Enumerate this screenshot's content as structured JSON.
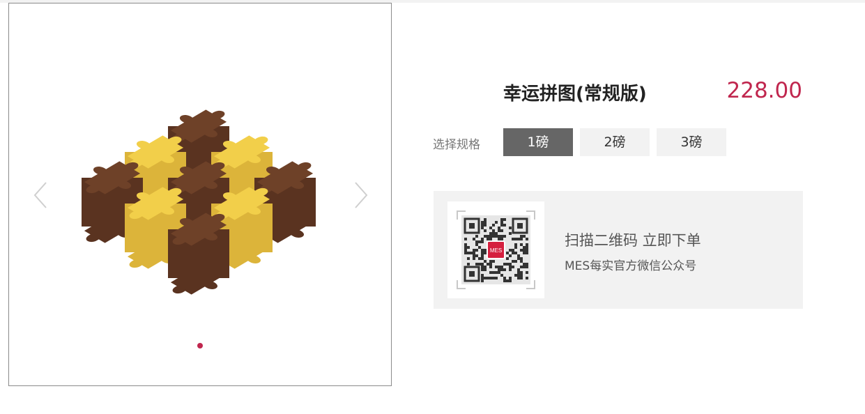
{
  "product": {
    "title": "幸运拼图(常规版)",
    "price": "228.00"
  },
  "spec": {
    "label": "选择规格",
    "options": [
      "1磅",
      "2磅",
      "3磅"
    ],
    "selected": "1磅"
  },
  "qr": {
    "line1": "扫描二维码 立即下单",
    "line2": "MES每实官方微信公众号",
    "logo_text": "MES"
  },
  "gallery": {
    "arrow_prev_icon": "chevron-left-icon",
    "arrow_next_icon": "chevron-right-icon"
  },
  "colors": {
    "accent": "#c0264e",
    "selected_bg": "#666666",
    "option_bg": "#f2f2f2",
    "chocolate": "#6e4128",
    "lemon": "#f2cf4a"
  }
}
